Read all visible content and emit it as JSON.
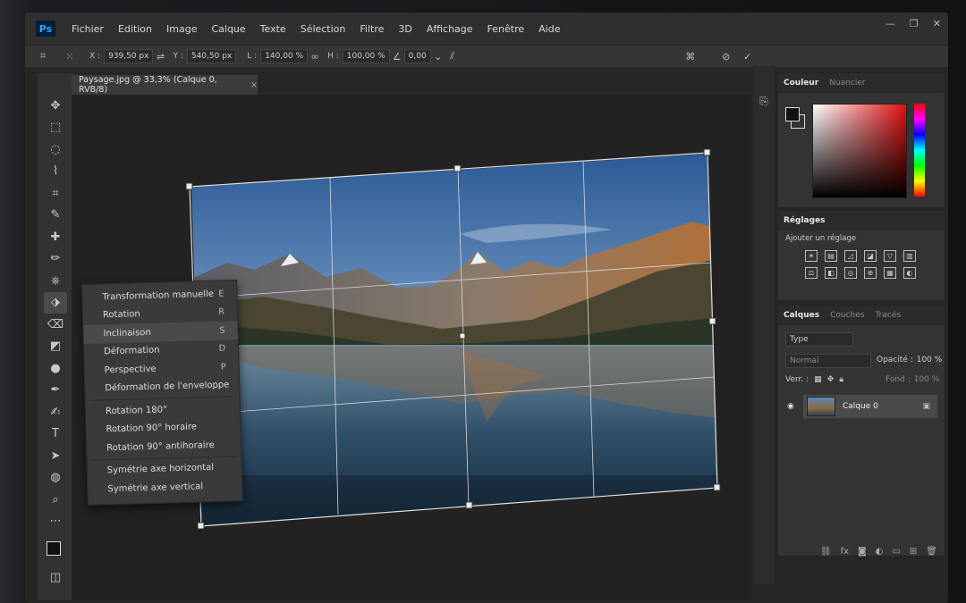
{
  "app": {
    "logo": "Ps"
  },
  "menu": [
    "Fichier",
    "Edition",
    "Image",
    "Calque",
    "Texte",
    "Sélection",
    "Filtre",
    "3D",
    "Affichage",
    "Fenêtre",
    "Aide"
  ],
  "options": {
    "x_label": "X :",
    "x_value": "939,50 px",
    "y_label": "Y :",
    "y_value": "540,50 px",
    "w_label": "L :",
    "w_value": "140,00 %",
    "h_label": "H :",
    "h_value": "100,00 %",
    "angle_value": "0,00"
  },
  "document": {
    "tab_title": "Paysage.jpg @ 33,3% (Calque 0, RVB/8)",
    "close": "×"
  },
  "context_menu": {
    "items": [
      {
        "label": "Transformation manuelle",
        "shortcut": "E"
      },
      {
        "label": "Rotation",
        "shortcut": "R"
      },
      {
        "label": "Inclinaison",
        "shortcut": "S"
      },
      {
        "label": "Déformation",
        "shortcut": "D"
      },
      {
        "label": "Perspective",
        "shortcut": "P"
      },
      {
        "label": "Déformation de l'enveloppe",
        "shortcut": ""
      },
      {
        "label": "Rotation 180°",
        "shortcut": ""
      },
      {
        "label": "Rotation 90° horaire",
        "shortcut": ""
      },
      {
        "label": "Rotation 90° antihoraire",
        "shortcut": ""
      },
      {
        "label": "Symétrie axe horizontal",
        "shortcut": ""
      },
      {
        "label": "Symétrie axe vertical",
        "shortcut": ""
      }
    ],
    "highlighted": "Inclinaison"
  },
  "panels": {
    "color": {
      "tab_active": "Couleur",
      "tab_inactive": "Nuancier"
    },
    "adjustments": {
      "title": "Réglages",
      "subtitle": "Ajouter un réglage"
    },
    "layers": {
      "tab_active": "Calques",
      "tab_2": "Couches",
      "tab_3": "Tracés",
      "filter_label": "Type",
      "blend_mode": "Normal",
      "opacity_label": "Opacité :",
      "opacity_value": "100 %",
      "lock_label": "Verr. :",
      "fill_label": "Fond :",
      "fill_value": "100 %",
      "layer_name": "Calque 0"
    }
  },
  "colors": {
    "accent": "#31a8ff",
    "panel_bg": "#333333",
    "menu_bg": "#2f2f2f"
  }
}
